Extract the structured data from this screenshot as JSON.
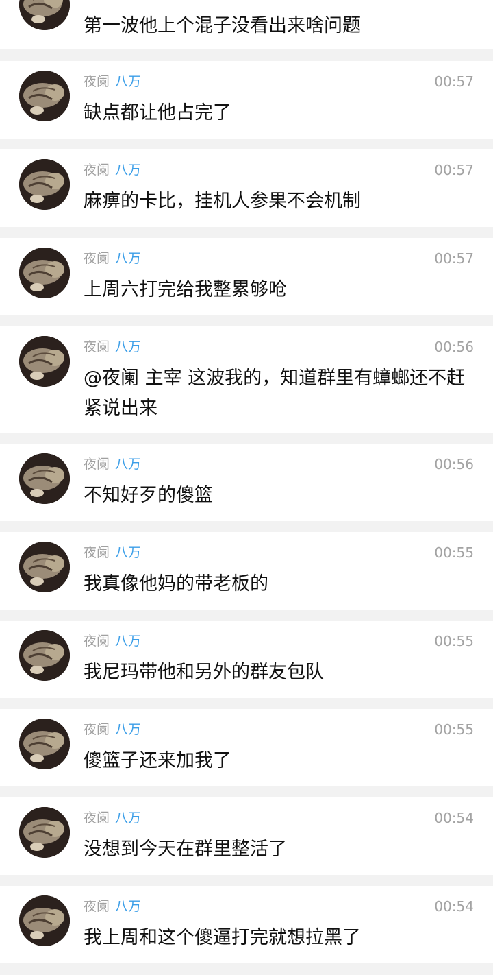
{
  "messages": [
    {
      "name": "",
      "tag": "",
      "time": "",
      "text": "第一波他上个混子没看出来啥问题"
    },
    {
      "name": "夜阑",
      "tag": "八万",
      "time": "00:57",
      "text": "缺点都让他占完了"
    },
    {
      "name": "夜阑",
      "tag": "八万",
      "time": "00:57",
      "text": "麻痹的卡比，挂机人参果不会机制"
    },
    {
      "name": "夜阑",
      "tag": "八万",
      "time": "00:57",
      "text": "上周六打完给我整累够呛"
    },
    {
      "name": "夜阑",
      "tag": "八万",
      "time": "00:56",
      "text": "@夜阑 主宰 这波我的，知道群里有蟑螂还不赶紧说出来"
    },
    {
      "name": "夜阑",
      "tag": "八万",
      "time": "00:56",
      "text": "不知好歹的傻篮"
    },
    {
      "name": "夜阑",
      "tag": "八万",
      "time": "00:55",
      "text": "我真像他妈的带老板的"
    },
    {
      "name": "夜阑",
      "tag": "八万",
      "time": "00:55",
      "text": "我尼玛带他和另外的群友包队"
    },
    {
      "name": "夜阑",
      "tag": "八万",
      "time": "00:55",
      "text": "傻篮子还来加我了"
    },
    {
      "name": "夜阑",
      "tag": "八万",
      "time": "00:54",
      "text": "没想到今天在群里整活了"
    },
    {
      "name": "夜阑",
      "tag": "八万",
      "time": "00:54",
      "text": "我上周和这个傻逼打完就想拉黑了"
    }
  ],
  "icons": {
    "avatar": "cat-photo-avatar"
  },
  "colors": {
    "group_tag": "#3b9ee8",
    "meta_gray": "#a0a0a0",
    "separator": "#f2f2f2"
  }
}
